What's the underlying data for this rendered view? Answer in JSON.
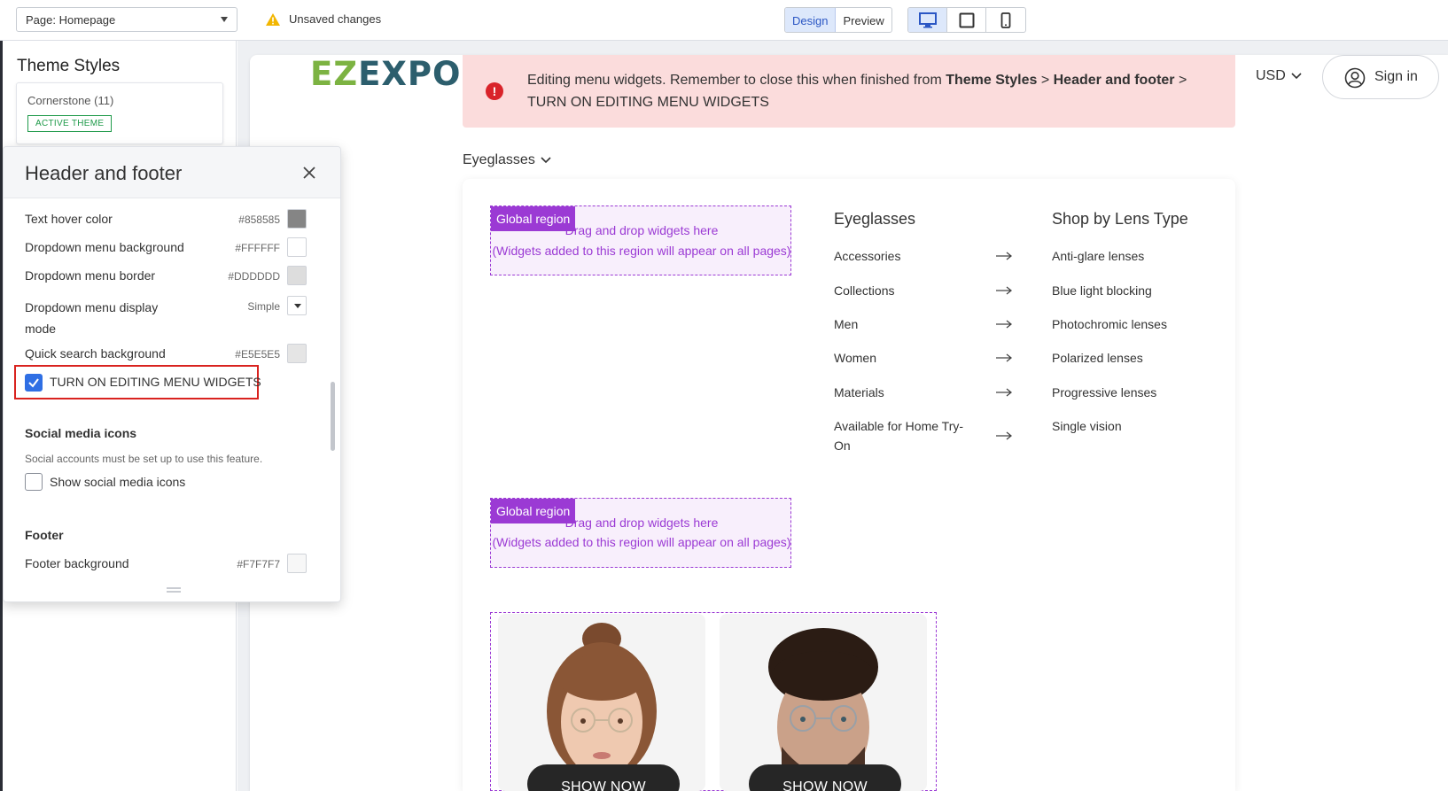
{
  "toolbar": {
    "page_select": "Page: Homepage",
    "unsaved": "Unsaved changes",
    "mode_design": "Design",
    "mode_preview": "Preview"
  },
  "sidebar": {
    "title": "Theme Styles",
    "theme_name": "Cornerstone (11)",
    "theme_badge": "ACTIVE THEME"
  },
  "panel": {
    "title": "Header and footer",
    "rows": [
      {
        "label": "Text hover color",
        "hex": "#858585",
        "color": "#858585"
      },
      {
        "label": "Dropdown menu background",
        "hex": "#FFFFFF",
        "color": "#FFFFFF"
      },
      {
        "label": "Dropdown menu border",
        "hex": "#DDDDDD",
        "color": "#DDDDDD"
      },
      {
        "label": "Dropdown menu display mode",
        "value": "Simple"
      },
      {
        "label": "Quick search background",
        "hex": "#E5E5E5",
        "color": "#E5E5E5"
      }
    ],
    "dropdown_label_line1": "Dropdown menu display",
    "dropdown_label_line2": "mode",
    "editing_checkbox": {
      "label": "TURN ON EDITING MENU WIDGETS",
      "checked": true
    },
    "social_title": "Social media icons",
    "social_help": "Social accounts must be set up to use this feature.",
    "social_checkbox": {
      "label": "Show social media icons",
      "checked": false
    },
    "footer_title": "Footer",
    "footer_bg": {
      "label": "Footer background",
      "hex": "#F7F7F7",
      "color": "#F7F7F7"
    }
  },
  "store": {
    "logo_ez": "EZ",
    "logo_expo": "EXPO",
    "alert_prefix": "Editing menu widgets. Remember to close this when finished from ",
    "alert_b1": "Theme Styles",
    "alert_sep1": " > ",
    "alert_b2": "Header and footer",
    "alert_sep2": " >",
    "alert_line2": "TURN ON EDITING MENU WIDGETS",
    "currency": "USD",
    "signin": "Sign in",
    "menu_trigger": "Eyeglasses",
    "region": {
      "tag": "Global region",
      "line1": "Drag and drop widgets here",
      "line2": "(Widgets added to this region will appear on all pages)"
    },
    "col1_title": "Eyeglasses",
    "col1_items": [
      "Accessories",
      "Collections",
      "Men",
      "Women",
      "Materials",
      "Available for Home Try-",
      "On"
    ],
    "col2_title": "Shop by Lens Type",
    "col2_items": [
      "Anti-glare lenses",
      "Blue light blocking",
      "Photochromic lenses",
      "Polarized lenses",
      "Progressive lenses",
      "Single vision"
    ],
    "shop_now": "SHOW NOW"
  },
  "colors": {
    "accent_blue": "#2f6fe4",
    "region_purple": "#9b3ad4",
    "alert_bg": "#fbdcdc",
    "highlight_red": "#d9231f"
  }
}
